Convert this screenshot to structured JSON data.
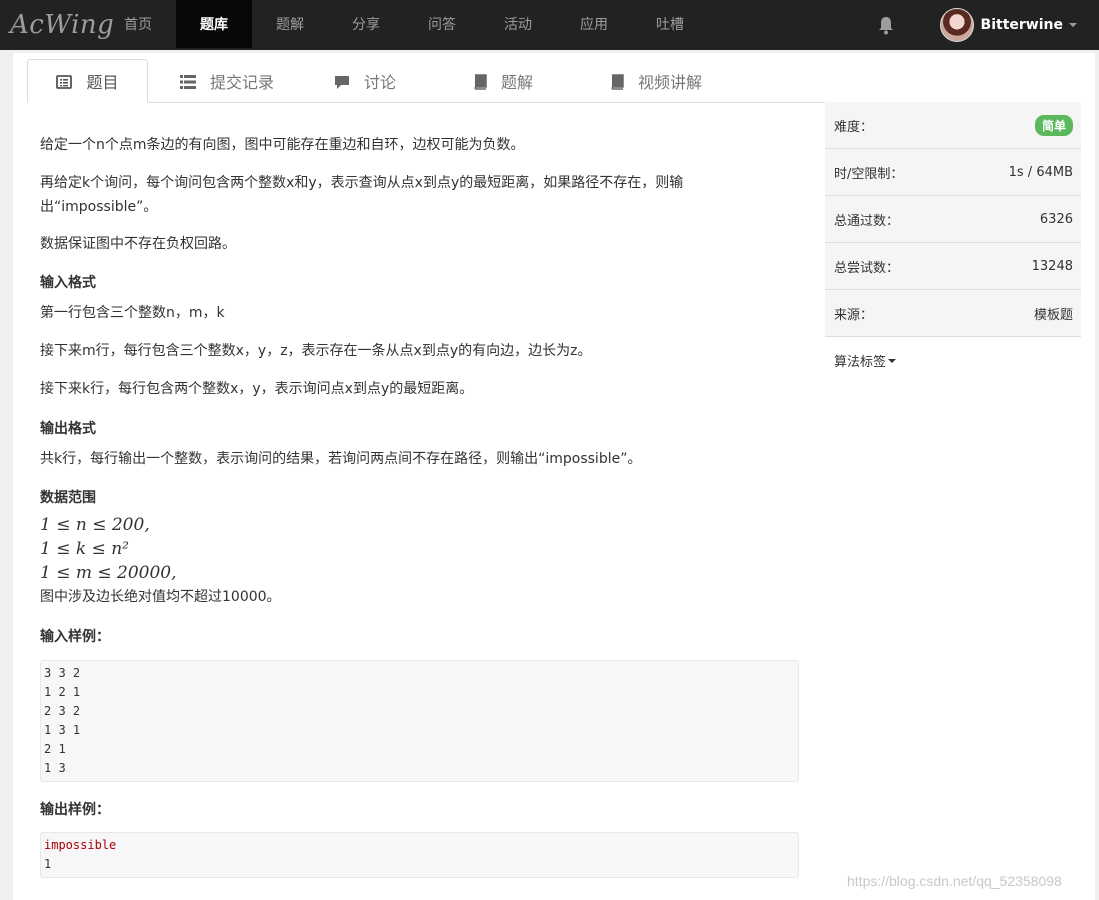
{
  "nav": {
    "logo": "AcWing",
    "items": [
      "首页",
      "题库",
      "题解",
      "分享",
      "问答",
      "活动",
      "应用",
      "吐槽"
    ],
    "active_index": 1,
    "bell_icon": "bell-icon",
    "username": "Bitterwine"
  },
  "tabs": [
    {
      "label": "题目",
      "icon": "list-alt-icon"
    },
    {
      "label": "提交记录",
      "icon": "list-icon"
    },
    {
      "label": "讨论",
      "icon": "comment-icon"
    },
    {
      "label": "题解",
      "icon": "book-icon"
    },
    {
      "label": "视频讲解",
      "icon": "book-icon"
    }
  ],
  "problem": {
    "desc1": "给定一个n个点m条边的有向图，图中可能存在重边和自环，边权可能为负数。",
    "desc2a": "再给定k个询问，每个询问包含两个整数x和y，表示查询从点x到点y的最短距离，如果路径不存在，则输",
    "desc2b": "出“impossible”。",
    "desc3": "数据保证图中不存在负权回路。",
    "input_title": "输入格式",
    "input1": "第一行包含三个整数n，m，k",
    "input2": "接下来m行，每行包含三个整数x，y，z，表示存在一条从点x到点y的有向边，边长为z。",
    "input3": "接下来k行，每行包含两个整数x，y，表示询问点x到点y的最短距离。",
    "output_title": "输出格式",
    "output1": "共k行，每行输出一个整数，表示询问的结果，若询问两点间不存在路径，则输出“impossible”。",
    "range_title": "数据范围",
    "range1": "1 ≤ n ≤ 200,",
    "range2": "1 ≤ k ≤ n²",
    "range3": "1 ≤ m ≤ 20000,",
    "range4": "图中涉及边长绝对值均不超过10000。",
    "sample_in_title": "输入样例：",
    "sample_in": [
      "3 3 2",
      "1 2 1",
      "2 3 2",
      "1 3 1",
      "2 1",
      "1 3"
    ],
    "sample_out_title": "输出样例：",
    "sample_out": [
      "impossible",
      "1"
    ]
  },
  "sidebar": [
    {
      "label": "难度：",
      "value": "简单"
    },
    {
      "label": "时/空限制：",
      "value": "1s / 64MB"
    },
    {
      "label": "总通过数：",
      "value": "6326"
    },
    {
      "label": "总尝试数：",
      "value": "13248"
    },
    {
      "label": "来源：",
      "value": "模板题"
    },
    {
      "label": "算法标签",
      "value": ""
    }
  ],
  "watermark": "https://blog.csdn.net/qq_52358098",
  "colors": {
    "navbar": "#222222",
    "badge": "#5cb85c",
    "active_nav": "#080808"
  }
}
